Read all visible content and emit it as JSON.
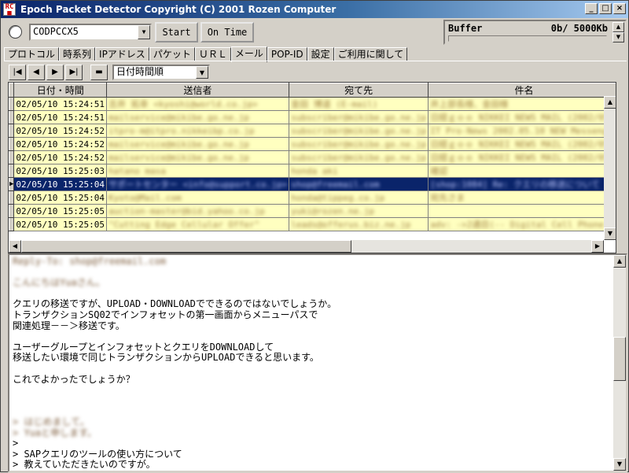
{
  "window": {
    "title": "Epoch Packet Detector  Copyright (C) 2001 Rozen Computer",
    "icon_text_top": "RC",
    "icon_text_bottom": "■"
  },
  "controls": {
    "device": "CODPCCX5",
    "start_label": "Start",
    "ontime_label": "On Time"
  },
  "buffer": {
    "label": "Buffer",
    "value": "0b/  5000Kb",
    "fill_percent": 0
  },
  "tabs": [
    {
      "label": "プロトコル"
    },
    {
      "label": "時系列"
    },
    {
      "label": "IPアドレス"
    },
    {
      "label": "パケット"
    },
    {
      "label": "ＵＲＬ"
    },
    {
      "label": "メール",
      "active": true
    },
    {
      "label": "POP-ID"
    },
    {
      "label": "設定"
    },
    {
      "label": "ご利用に関して"
    }
  ],
  "sort": {
    "selected": "日付時間順"
  },
  "table": {
    "headers": [
      "日付・時間",
      "送信者",
      "宛て先",
      "件名"
    ],
    "rows": [
      {
        "date": "02/05/10 15:24:51",
        "from": "吉井 拓幸 <kyoshi@world.co.jp>",
        "to": "金田 博道 (E-mail)",
        "subject": "井上部長様、金田様"
      },
      {
        "date": "02/05/10 15:24:51",
        "from": "mailservice@mikibe.go.ne.jp",
        "to": "subscriber@mikibe.go.ne.jp",
        "subject": "日経ｇｏｏ NIKKEI NEWS MAIL (2002/05/"
      },
      {
        "date": "02/05/10 15:24:52",
        "from": "itpro-m@itpro.nikkeibp.co.jp",
        "to": "subscriber@mikibe.go.ne.jp",
        "subject": "IT Pro-News 2002.05.10 NEW Messenger"
      },
      {
        "date": "02/05/10 15:24:52",
        "from": "mailservice@mikibe.go.ne.jp",
        "to": "subscriber@mikibe.go.ne.jp",
        "subject": "日経ｇｏｏ NIKKEI NEWS MAIL (2002/05/"
      },
      {
        "date": "02/05/10 15:24:52",
        "from": "mailservice@mikibe.go.ne.jp",
        "to": "subscriber@mikibe.go.ne.jp",
        "subject": "日経ｇｏｏ NIKKEI NEWS MAIL (2002/05/"
      },
      {
        "date": "02/05/10 15:25:03",
        "from": "hatano masa",
        "to": "honda aki",
        "subject": "確認"
      },
      {
        "date": "02/05/10 15:25:04",
        "from": "サポートセンター <info@support.co.jp>",
        "to": "shop@freemail.com",
        "subject": "[shop:1084] Re: クエリの移送について",
        "selected": true
      },
      {
        "date": "02/05/10 15:25:04",
        "from": "Kyoto@Mail.com",
        "to": "honda@tippeg.co.jp",
        "subject": "宛先さま"
      },
      {
        "date": "02/05/10 15:25:05",
        "from": "auction-master@bid.yahoo.co.jp",
        "to": "yuki@rozen.ne.jp",
        "subject": ""
      },
      {
        "date": "02/05/10 15:25:05",
        "from": "\"Cutting Edge Cellular Offer\"",
        "to": "leads@offerus.biz.ne.jp",
        "subject": "adv: ->2通目(-- Digital Cell Phone ("
      }
    ]
  },
  "message": {
    "lines": [
      {
        "text": "Reply-To: shop@freemail.com",
        "blur": true
      },
      {
        "text": "",
        "blur": false
      },
      {
        "text": "こんにちはYuaさん。",
        "blur": true
      },
      {
        "text": "",
        "blur": false
      },
      {
        "text": "クエリの移送ですが、UPLOAD・DOWNLOADでできるのではないでしょうか。",
        "blur": false
      },
      {
        "text": "トランザクションSQ02でインフォセットの第一画面からメニューパスで",
        "blur": false
      },
      {
        "text": "関連処理－－＞移送です。",
        "blur": false
      },
      {
        "text": "",
        "blur": false
      },
      {
        "text": "ユーザーグループとインフォセットとクエリをDOWNLOADして",
        "blur": false
      },
      {
        "text": "移送したい環境で同じトランザクションからUPLOADできると思います。",
        "blur": false
      },
      {
        "text": "",
        "blur": false
      },
      {
        "text": "これでよかったでしょうか？",
        "blur": false
      },
      {
        "text": "",
        "blur": false
      },
      {
        "text": "",
        "blur": false
      },
      {
        "text": "",
        "blur": false
      },
      {
        "text": "> はじめまして。",
        "blur": true
      },
      {
        "text": "> Yuaと申します。",
        "blur": true
      },
      {
        "text": ">",
        "blur": false
      },
      {
        "text": "> SAPクエリのツールの使い方について",
        "blur": false
      },
      {
        "text": "> 教えていただきたいのですが。",
        "blur": false
      },
      {
        "text": ">",
        "blur": false
      }
    ]
  }
}
